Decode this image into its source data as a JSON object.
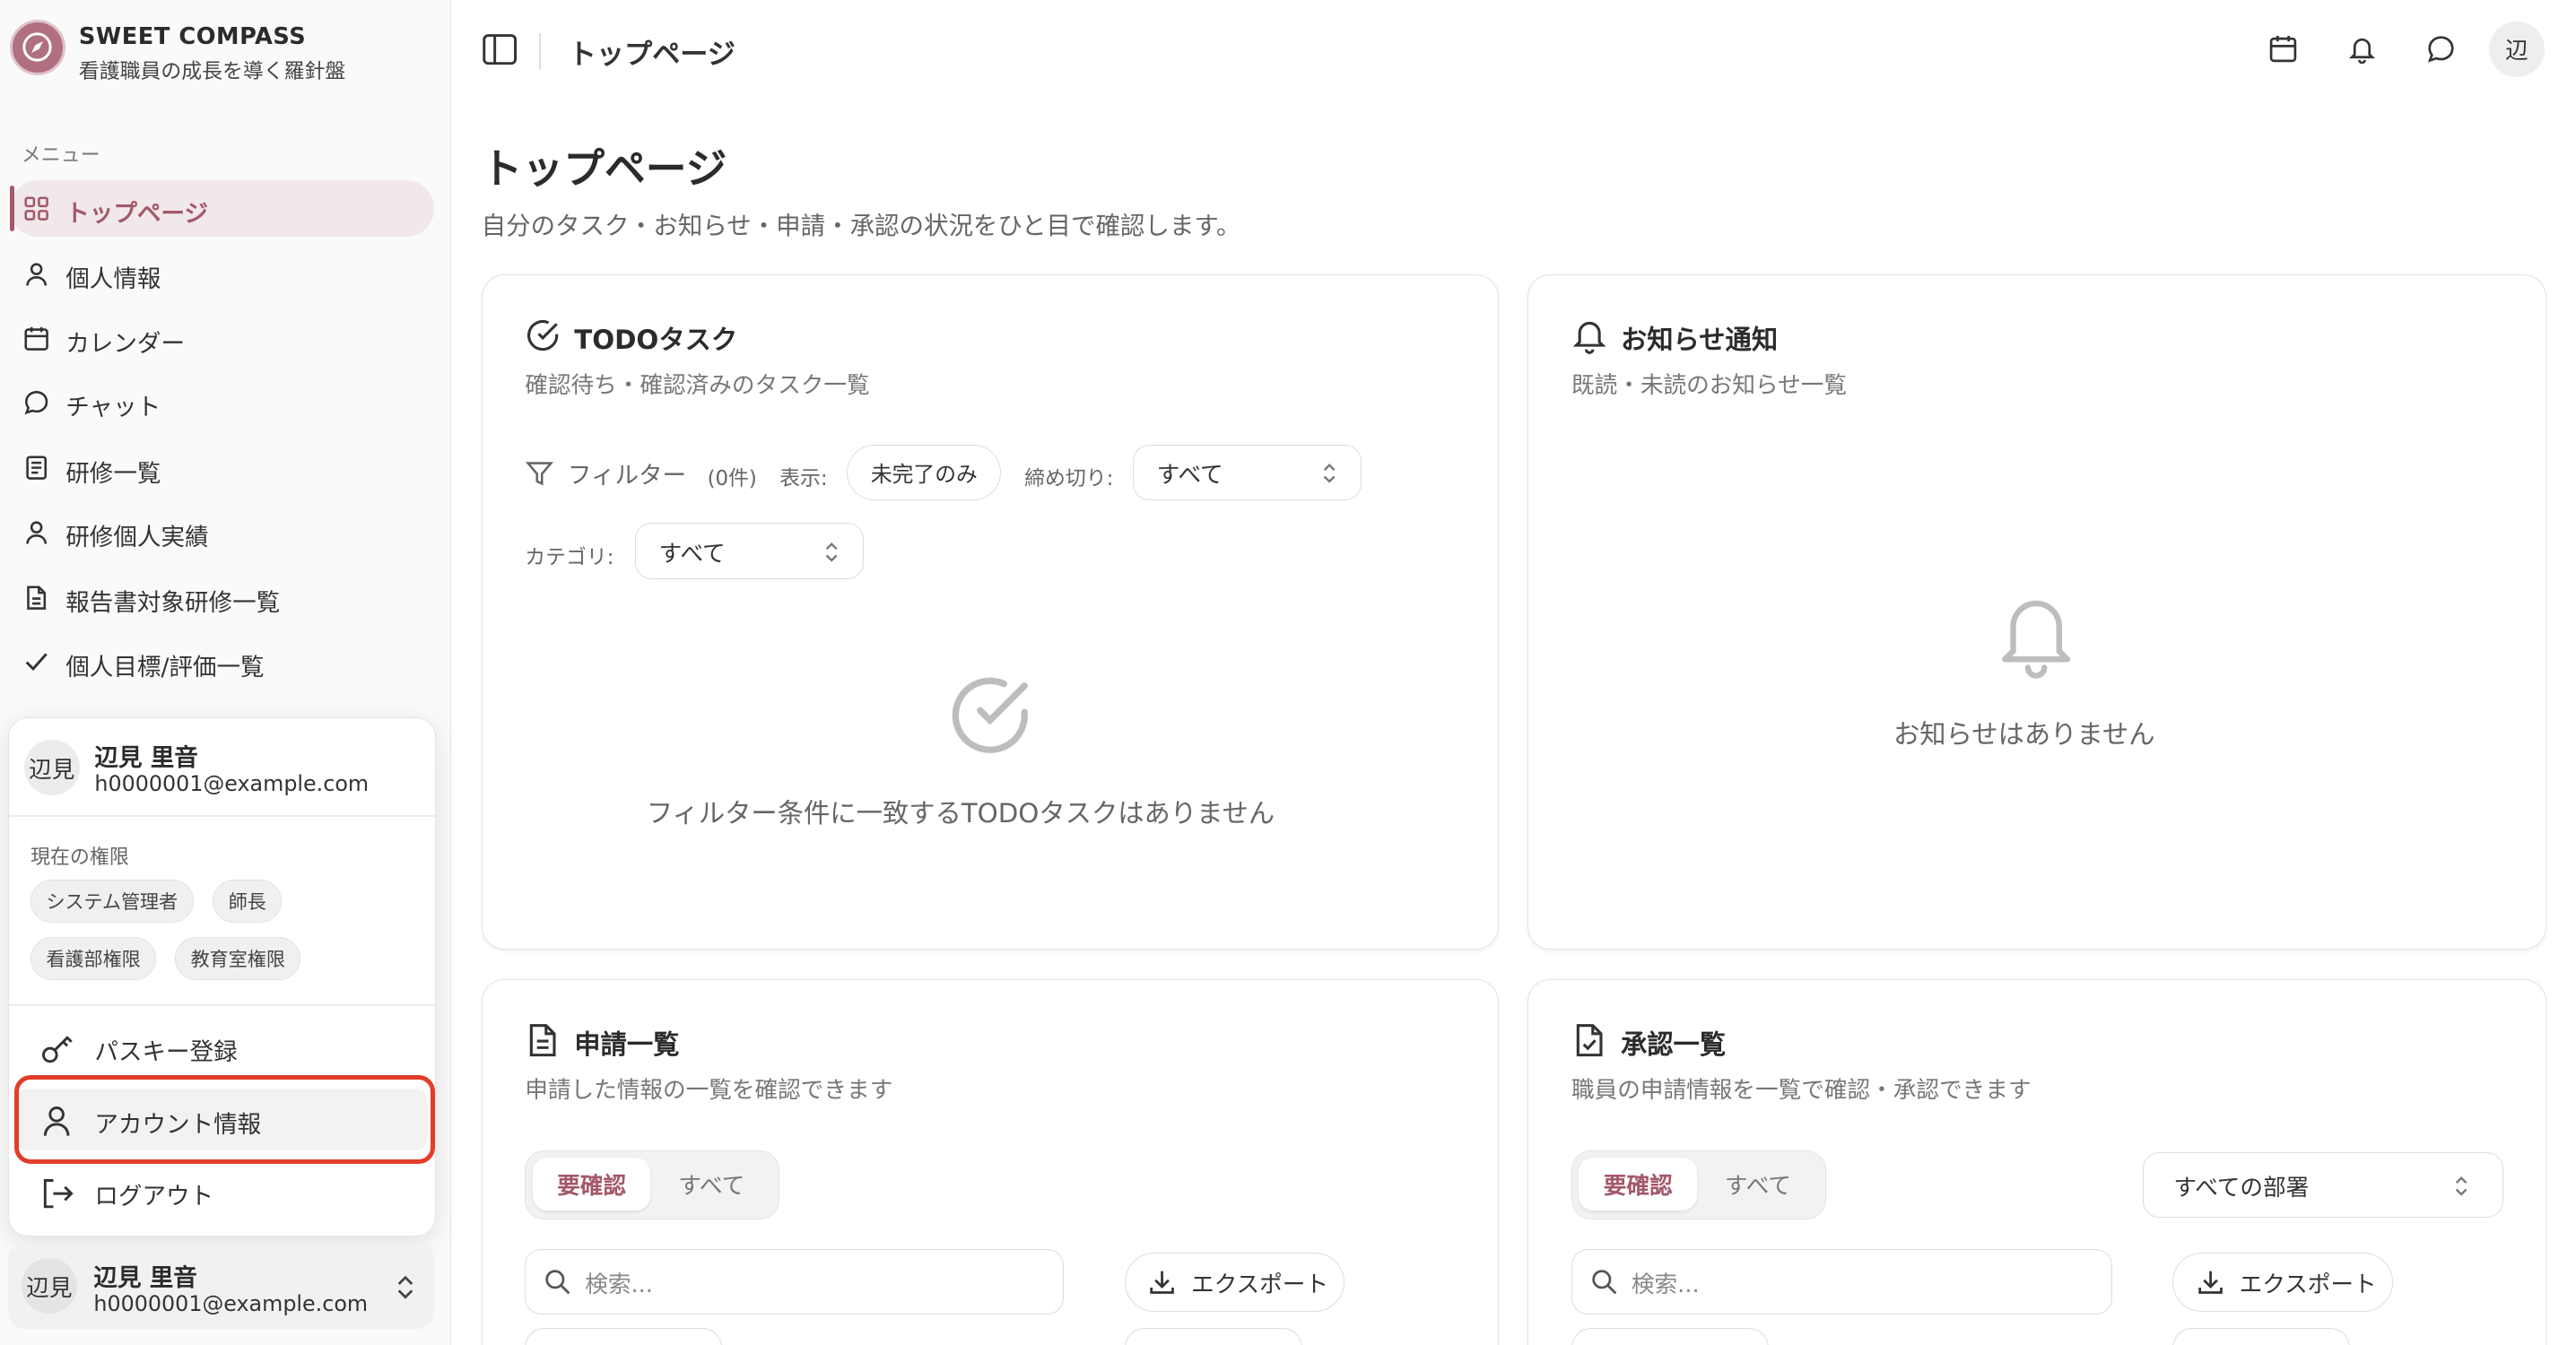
{
  "app": {
    "brand_name": "SWEET COMPASS",
    "brand_tagline": "看護職員の成長を導く羅針盤"
  },
  "sidebar": {
    "menu_label": "メニュー",
    "items": [
      {
        "label": "トップページ",
        "icon": "grid-icon",
        "active": true
      },
      {
        "label": "個人情報",
        "icon": "user-icon"
      },
      {
        "label": "カレンダー",
        "icon": "calendar-icon"
      },
      {
        "label": "チャット",
        "icon": "chat-icon"
      },
      {
        "label": "研修一覧",
        "icon": "document-list-icon"
      },
      {
        "label": "研修個人実績",
        "icon": "user-icon"
      },
      {
        "label": "報告書対象研修一覧",
        "icon": "file-text-icon"
      },
      {
        "label": "個人目標/評価一覧",
        "icon": "check-icon"
      }
    ]
  },
  "user_popup": {
    "avatar_text": "辺見",
    "name": "辺見 里音",
    "email": "h0000001@example.com",
    "permissions_label": "現在の権限",
    "permissions": [
      "システム管理者",
      "師長",
      "看護部権限",
      "教育室権限"
    ],
    "actions": [
      {
        "label": "パスキー登録",
        "icon": "key-icon"
      },
      {
        "label": "アカウント情報",
        "icon": "user-icon",
        "highlighted": true
      },
      {
        "label": "ログアウト",
        "icon": "logout-icon"
      }
    ]
  },
  "user_footer": {
    "avatar_text": "辺見",
    "name": "辺見 里音",
    "email": "h0000001@example.com"
  },
  "topbar": {
    "title": "トップページ",
    "avatar_text": "辺",
    "icons": [
      "sidebar-toggle-icon",
      "calendar-icon",
      "bell-icon",
      "chat-icon"
    ]
  },
  "page": {
    "title": "トップページ",
    "subtitle": "自分のタスク・お知らせ・申請・承認の状況をひと目で確認します。"
  },
  "todo_card": {
    "title": "TODOタスク",
    "subtitle": "確認待ち・確認済みのタスク一覧",
    "filter_label": "フィルター",
    "filter_count": "(0件)",
    "display_label": "表示:",
    "display_value": "未完了のみ",
    "deadline_label": "締め切り:",
    "deadline_value": "すべて",
    "category_label": "カテゴリ:",
    "category_value": "すべて",
    "empty_text": "フィルター条件に一致するTODOタスクはありません"
  },
  "notice_card": {
    "title": "お知らせ通知",
    "subtitle": "既読・未読のお知らせ一覧",
    "empty_text": "お知らせはありません"
  },
  "application_card": {
    "title": "申請一覧",
    "subtitle": "申請した情報の一覧を確認できます",
    "tab_active": "要確認",
    "tab_inactive": "すべて",
    "search_placeholder": "検索...",
    "export_label": "エクスポート"
  },
  "approval_card": {
    "title": "承認一覧",
    "subtitle": "職員の申請情報を一覧で確認・承認できます",
    "tab_active": "要確認",
    "tab_inactive": "すべて",
    "department_value": "すべての部署",
    "search_placeholder": "検索...",
    "export_label": "エクスポート"
  },
  "colors": {
    "accent": "#a4586a",
    "accent_bg": "#f1e8eb",
    "highlight_border": "#e23d2a"
  }
}
